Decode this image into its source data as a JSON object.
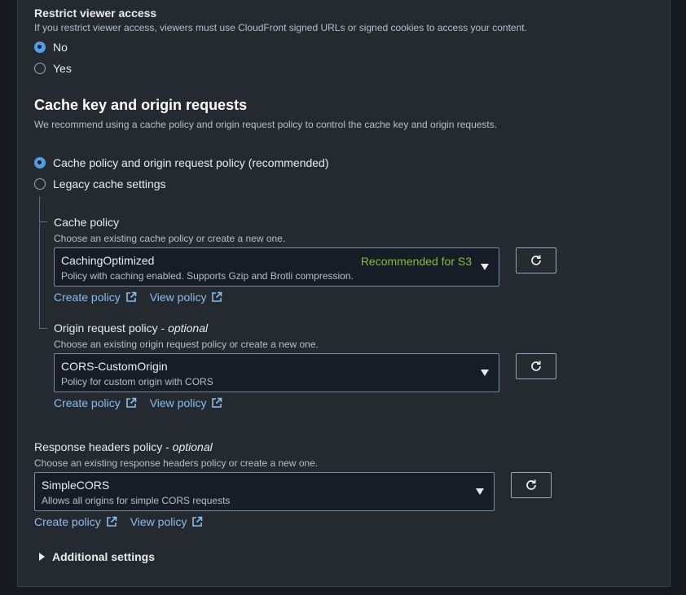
{
  "restrict": {
    "label": "Restrict viewer access",
    "description": "If you restrict viewer access, viewers must use CloudFront signed URLs or signed cookies to access your content.",
    "options": [
      {
        "label": "No",
        "selected": true
      },
      {
        "label": "Yes",
        "selected": false
      }
    ]
  },
  "cache_section": {
    "heading": "Cache key and origin requests",
    "description": "We recommend using a cache policy and origin request policy to control the cache key and origin requests.",
    "options": [
      {
        "label": "Cache policy and origin request policy (recommended)",
        "selected": true
      },
      {
        "label": "Legacy cache settings",
        "selected": false
      }
    ]
  },
  "cache_policy": {
    "label": "Cache policy",
    "description": "Choose an existing cache policy or create a new one.",
    "selected": "CachingOptimized",
    "selected_desc": "Policy with caching enabled. Supports Gzip and Brotli compression.",
    "tag": "Recommended for S3",
    "create_link": "Create policy",
    "view_link": "View policy"
  },
  "origin_policy": {
    "label": "Origin request policy",
    "optional": "optional",
    "description": "Choose an existing origin request policy or create a new one.",
    "selected": "CORS-CustomOrigin",
    "selected_desc": "Policy for custom origin with CORS",
    "create_link": "Create policy",
    "view_link": "View policy"
  },
  "response_policy": {
    "label": "Response headers policy",
    "optional": "optional",
    "description": "Choose an existing response headers policy or create a new one.",
    "selected": "SimpleCORS",
    "selected_desc": "Allows all origins for simple CORS requests",
    "create_link": "Create policy",
    "view_link": "View policy"
  },
  "additional": {
    "label": "Additional settings"
  },
  "colors": {
    "background": "#252a31",
    "link": "#89bdee",
    "accent": "#539fe5",
    "tag": "#7fbf3f"
  },
  "icons": {
    "refresh": "refresh-icon",
    "external": "external-link-icon",
    "caret": "caret-down-icon",
    "expand": "caret-right-icon"
  }
}
